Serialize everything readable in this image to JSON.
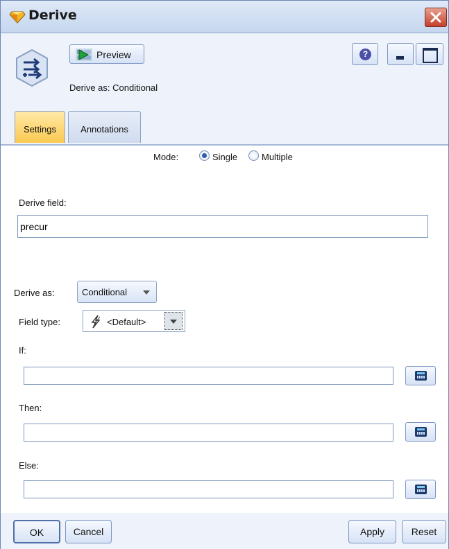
{
  "window": {
    "title": "Derive",
    "close_label": "X"
  },
  "toolbar": {
    "preview_label": "Preview",
    "derive_as_caption": "Derive as: Conditional",
    "help_label": "?"
  },
  "tabs": [
    {
      "label": "Settings",
      "active": true
    },
    {
      "label": "Annotations",
      "active": false
    }
  ],
  "settings": {
    "mode_label": "Mode:",
    "mode_options": [
      {
        "label": "Single",
        "checked": true
      },
      {
        "label": "Multiple",
        "checked": false
      }
    ],
    "derive_field_label": "Derive field:",
    "derive_field_value": "precur",
    "derive_as_label": "Derive as:",
    "derive_as_value": "Conditional",
    "field_type_label": "Field type:",
    "field_type_value": "<Default>",
    "if_label": "If:",
    "if_value": "",
    "then_label": "Then:",
    "then_value": "",
    "else_label": "Else:",
    "else_value": ""
  },
  "footer": {
    "ok_label": "OK",
    "cancel_label": "Cancel",
    "apply_label": "Apply",
    "reset_label": "Reset"
  },
  "colors": {
    "active_tab": "#fbc94f",
    "window_bg": "#e9effa",
    "close_button": "#c5402a"
  }
}
